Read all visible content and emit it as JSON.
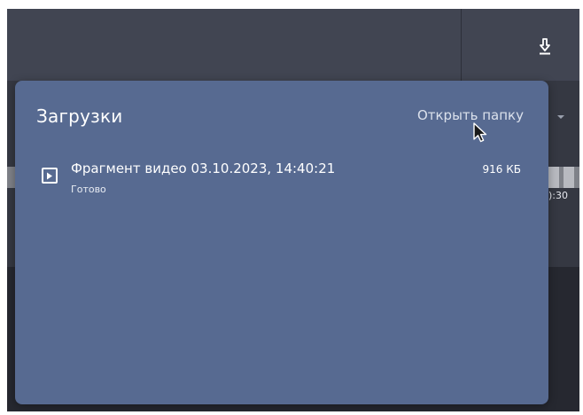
{
  "downloads_panel": {
    "title": "Загрузки",
    "open_folder_label": "Открыть папку",
    "items": [
      {
        "name": "Фрагмент видео 03.10.2023, 14:40:21",
        "status": "Готово",
        "size": "916 КБ",
        "icon": "video-file-icon"
      }
    ]
  },
  "background": {
    "peek_time": "):30"
  },
  "colors": {
    "panel": "#576a91",
    "toolbar": "#414552",
    "app_bg": "#353842"
  }
}
